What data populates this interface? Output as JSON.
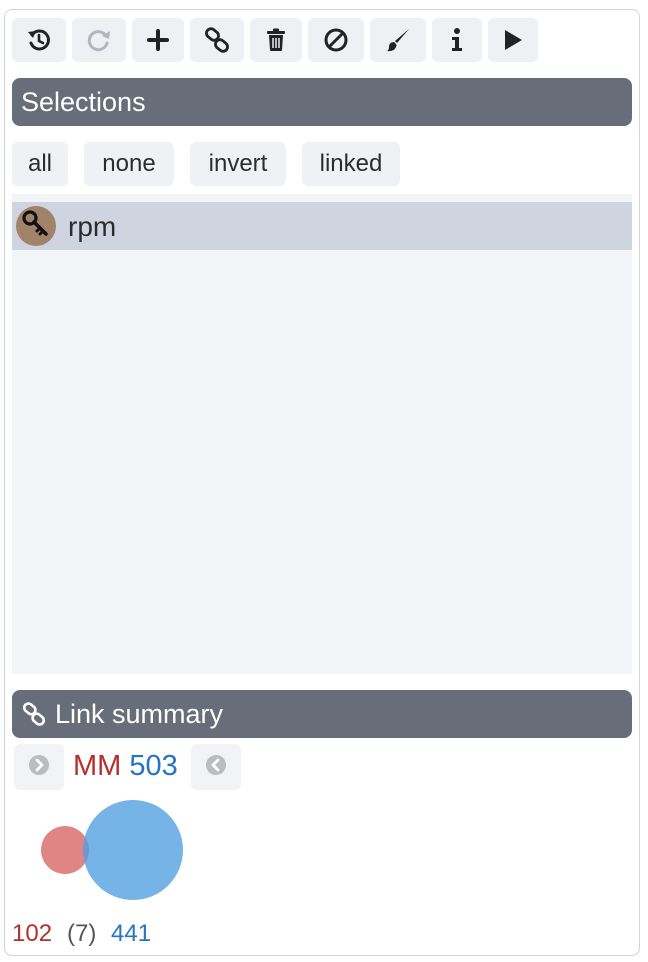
{
  "toolbar": {
    "buttons": [
      {
        "name": "undo-button",
        "icon": "undo-history-icon",
        "enabled": true
      },
      {
        "name": "redo-button",
        "icon": "redo-icon",
        "enabled": false
      },
      {
        "name": "add-button",
        "icon": "plus-icon",
        "enabled": true
      },
      {
        "name": "link-button",
        "icon": "link-icon",
        "enabled": true
      },
      {
        "name": "delete-button",
        "icon": "trash-icon",
        "enabled": true
      },
      {
        "name": "clear-button",
        "icon": "ban-icon",
        "enabled": true
      },
      {
        "name": "paint-button",
        "icon": "brush-icon",
        "enabled": true
      },
      {
        "name": "info-button",
        "icon": "info-icon",
        "enabled": true
      },
      {
        "name": "play-button",
        "icon": "play-icon",
        "enabled": true
      }
    ]
  },
  "selections": {
    "header": "Selections",
    "buttons": {
      "all": "all",
      "none": "none",
      "invert": "invert",
      "linked": "linked"
    },
    "items": [
      {
        "label": "rpm",
        "icon": "key-icon",
        "avatar_color": "#a1836a",
        "selected": true
      }
    ]
  },
  "link_summary": {
    "header": "Link summary",
    "left_label": "MM",
    "right_label": "503",
    "left_count": "102",
    "overlap_count": "(7)",
    "right_count": "441",
    "left_color": "#b5302d",
    "right_color": "#2475c2",
    "venn": {
      "left_size": 102,
      "right_size": 441,
      "overlap": 7
    }
  },
  "colors": {
    "header_bg": "#676e79",
    "selected_row_bg": "#cfd5e0",
    "list_bg": "#f4f5f9"
  }
}
